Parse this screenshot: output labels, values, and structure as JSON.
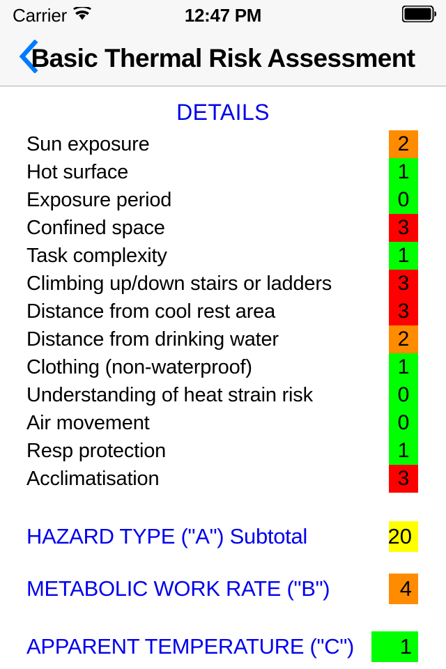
{
  "status_bar": {
    "carrier": "Carrier",
    "wifi_icon": "wifi-icon",
    "time": "12:47 PM",
    "battery_icon": "battery-full-icon"
  },
  "nav_bar": {
    "back_icon": "chevron-left-icon",
    "title": "Basic Thermal Risk Assessment",
    "accent_color": "#007aff"
  },
  "details": {
    "header": "DETAILS",
    "header_color": "#0000ee",
    "rows": [
      {
        "label": "Sun exposure",
        "score": "2",
        "color": "#ff8c00"
      },
      {
        "label": "Hot surface",
        "score": "1",
        "color": "#00ff00"
      },
      {
        "label": "Exposure period",
        "score": "0",
        "color": "#00ff00"
      },
      {
        "label": "Confined space",
        "score": "3",
        "color": "#ff0000"
      },
      {
        "label": "Task complexity",
        "score": "1",
        "color": "#00ff00"
      },
      {
        "label": "Climbing up/down stairs or ladders",
        "score": "3",
        "color": "#ff0000"
      },
      {
        "label": "Distance from cool rest area",
        "score": "3",
        "color": "#ff0000"
      },
      {
        "label": "Distance from drinking water",
        "score": "2",
        "color": "#ff8c00"
      },
      {
        "label": "Clothing (non-waterproof)",
        "score": "1",
        "color": "#00ff00"
      },
      {
        "label": "Understanding of heat strain risk",
        "score": "0",
        "color": "#00ff00"
      },
      {
        "label": "Air movement",
        "score": "0",
        "color": "#00ff00"
      },
      {
        "label": "Resp protection",
        "score": "1",
        "color": "#00ff00"
      },
      {
        "label": "Acclimatisation",
        "score": "3",
        "color": "#ff0000"
      }
    ]
  },
  "summary": {
    "rows": [
      {
        "label": "HAZARD TYPE (\"A\") Subtotal",
        "score": "20",
        "color": "#ffff00",
        "width": "narrow"
      },
      {
        "label": "METABOLIC WORK RATE (\"B\")",
        "score": "4",
        "color": "#ff8c00",
        "width": "narrow"
      },
      {
        "label": "APPARENT TEMPERATURE (\"C\")",
        "score": "1",
        "color": "#00ff00",
        "width": "wide"
      }
    ]
  },
  "palette": {
    "green": "#00ff00",
    "orange": "#ff8c00",
    "red": "#ff0000",
    "yellow": "#ffff00",
    "blue_text": "#0000ee",
    "ios_blue": "#007aff"
  }
}
